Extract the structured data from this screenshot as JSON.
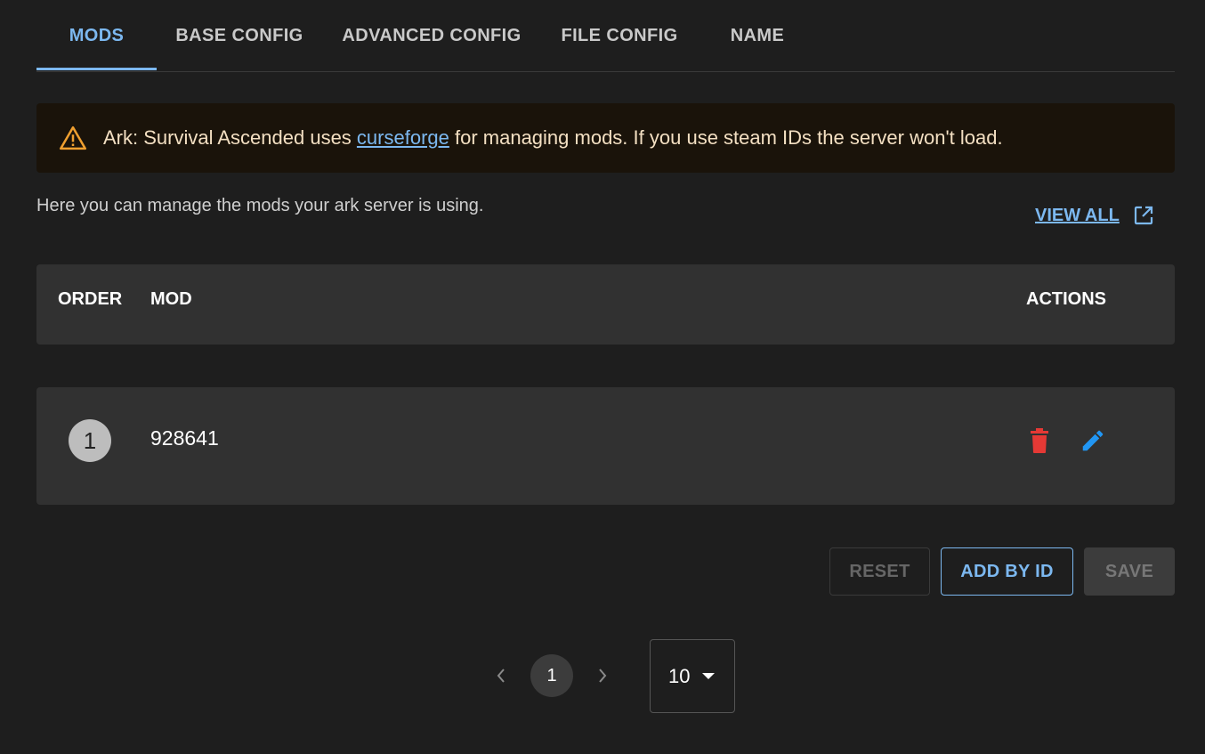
{
  "tabs": [
    {
      "label": "MODS",
      "active": true
    },
    {
      "label": "BASE CONFIG",
      "active": false
    },
    {
      "label": "ADVANCED CONFIG",
      "active": false
    },
    {
      "label": "FILE CONFIG",
      "active": false
    },
    {
      "label": "NAME",
      "active": false
    }
  ],
  "alert": {
    "icon": "warning-icon",
    "text_before": "Ark: Survival Ascended uses ",
    "link_text": "curseforge",
    "text_after": " for managing mods. If you use steam IDs the server won't load.",
    "color": "#f0a030"
  },
  "intro": "Here you can manage the mods your ark server is using.",
  "view_all": {
    "label": "VIEW ALL",
    "icon": "external-link-icon"
  },
  "table": {
    "headers": {
      "order": "ORDER",
      "mod": "MOD",
      "actions": "ACTIONS"
    },
    "rows": [
      {
        "order": "1",
        "mod": "928641",
        "actions": [
          "delete-icon",
          "edit-icon"
        ]
      }
    ]
  },
  "buttons": {
    "reset": "RESET",
    "add_by_id": "ADD BY ID",
    "save": "SAVE"
  },
  "pagination": {
    "page": "1",
    "page_size": "10"
  },
  "colors": {
    "accent": "#7cb8f0",
    "delete": "#e53935",
    "edit": "#2196f3",
    "warning": "#f0a030"
  }
}
